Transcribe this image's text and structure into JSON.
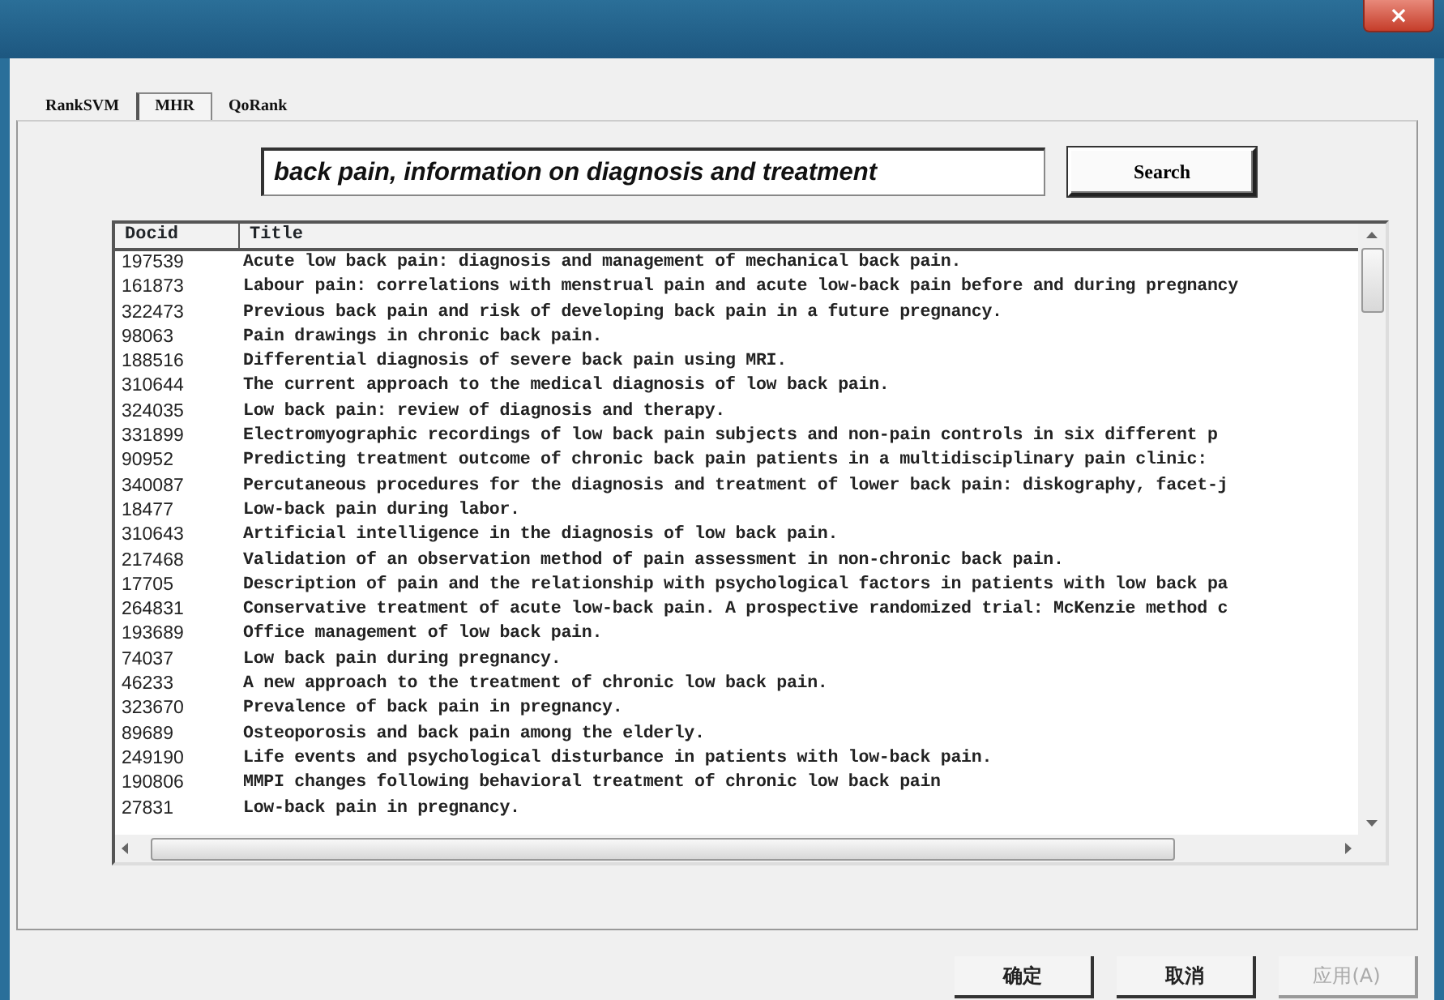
{
  "window": {
    "close": "×"
  },
  "tabs": [
    {
      "label": "RankSVM",
      "selected": false
    },
    {
      "label": "MHR",
      "selected": true
    },
    {
      "label": "QoRank",
      "selected": false
    }
  ],
  "search": {
    "value": "back pain, information on diagnosis and treatment",
    "button": "Search"
  },
  "table": {
    "columns": [
      "Docid",
      "Title"
    ],
    "rows": [
      [
        "197539",
        "Acute low back pain: diagnosis and management of mechanical back pain."
      ],
      [
        "161873",
        "Labour pain: correlations with menstrual pain and acute low-back pain before and during pregnancy"
      ],
      [
        "322473",
        "Previous back pain and risk of developing back pain in a future pregnancy."
      ],
      [
        "98063",
        "Pain drawings in chronic back pain."
      ],
      [
        "188516",
        "Differential diagnosis of severe back pain using MRI."
      ],
      [
        "310644",
        "The current approach to the medical diagnosis of low back pain."
      ],
      [
        "324035",
        "Low back pain: review of diagnosis and therapy."
      ],
      [
        "331899",
        "Electromyographic recordings of low back pain subjects and non-pain controls in six different p"
      ],
      [
        "90952",
        "Predicting treatment outcome of chronic back pain patients in a multidisciplinary pain clinic:"
      ],
      [
        "340087",
        "Percutaneous procedures for the diagnosis and treatment of lower back pain: diskography, facet-j"
      ],
      [
        "18477",
        "Low-back pain during labor."
      ],
      [
        "310643",
        "Artificial intelligence in the diagnosis of low back pain."
      ],
      [
        "217468",
        "Validation of an observation method of pain assessment in non-chronic back pain."
      ],
      [
        "17705",
        "Description of pain and the relationship with psychological factors in patients with low back pa"
      ],
      [
        "264831",
        "Conservative treatment of acute low-back pain. A prospective randomized trial: McKenzie method c"
      ],
      [
        "193689",
        "Office management of low back pain."
      ],
      [
        "74037",
        "Low back pain during pregnancy."
      ],
      [
        "46233",
        "A new approach to the treatment of chronic low back pain."
      ],
      [
        "323670",
        "Prevalence of back pain in pregnancy."
      ],
      [
        "89689",
        "Osteoporosis and back pain among the elderly."
      ],
      [
        "249190",
        "Life events and psychological disturbance in patients with low-back pain."
      ],
      [
        "190806",
        "MMPI changes following behavioral treatment of chronic low back pain"
      ],
      [
        "27831",
        "Low-back pain in pregnancy."
      ]
    ]
  },
  "buttons": [
    {
      "label": "确定",
      "disabled": false
    },
    {
      "label": "取消",
      "disabled": false
    },
    {
      "label": "应用(A)",
      "disabled": true
    }
  ]
}
